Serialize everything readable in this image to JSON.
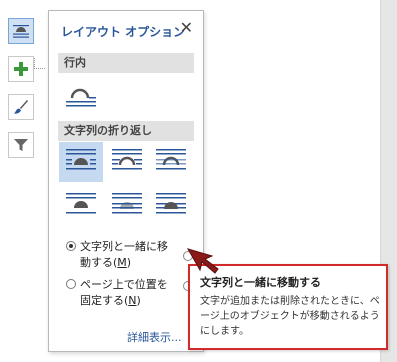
{
  "panel": {
    "title": "レイアウト オプション",
    "close_symbol": "✕",
    "section_inline": "行内",
    "section_wrap": "文字列の折り返し",
    "radio_move_with_text_line1": "文字列と一緒に移",
    "radio_move_with_text_line2_pre": "動する(",
    "radio_move_with_text_key": "M",
    "radio_move_with_text_line2_post": ")",
    "radio_fixed_line1": "ページ上で位置を",
    "radio_fixed_line2_pre": "固定する(",
    "radio_fixed_key": "N",
    "radio_fixed_line2_post": ")",
    "selected_option": "move_with_text",
    "detail_link": "詳細表示..."
  },
  "tooltip": {
    "title": "文字列と一緒に移動する",
    "body": "文字が追加または削除されたときに、ページ上のオブジェクトが移動されるようにします。"
  },
  "toolbar": {
    "icons": [
      "layout-options-icon",
      "plus-icon",
      "brush-icon",
      "filter-icon"
    ]
  },
  "colors": {
    "accent_blue": "#2b579a",
    "selected_bg": "#c5d9f1",
    "tooltip_border": "#d22a2a",
    "section_bg": "#e1e1e1"
  }
}
